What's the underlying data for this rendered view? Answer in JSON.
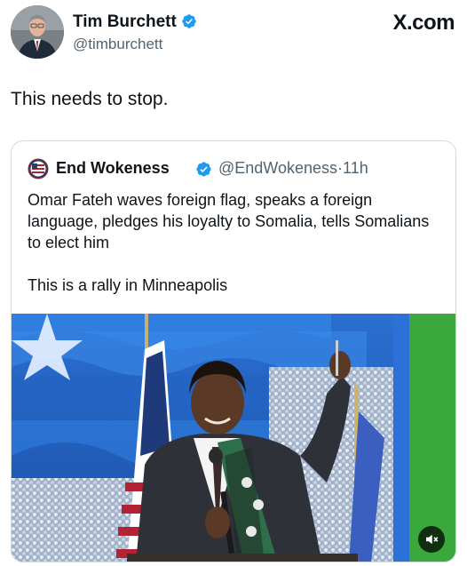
{
  "post": {
    "author_name": "Tim Burchett",
    "author_handle": "@timburchett",
    "site_label": "X.com",
    "text": "This needs to stop."
  },
  "quoted_post": {
    "author_name": "End Wokeness",
    "author_handle": "@EndWokeness",
    "separator": "·",
    "time": "11h",
    "body_paragraph_1": "Omar Fateh waves foreign flag, speaks a foreign language, pledges his loyalty to Somalia, tells Somalians to elect him",
    "body_paragraph_2": "This is a rally in Minneapolis"
  },
  "media": {
    "type": "video",
    "mute_icon": "speaker-muted-icon"
  },
  "colors": {
    "verified_badge": "#1d9bf0",
    "secondary_text": "#536471",
    "card_border": "#cfd9de"
  }
}
